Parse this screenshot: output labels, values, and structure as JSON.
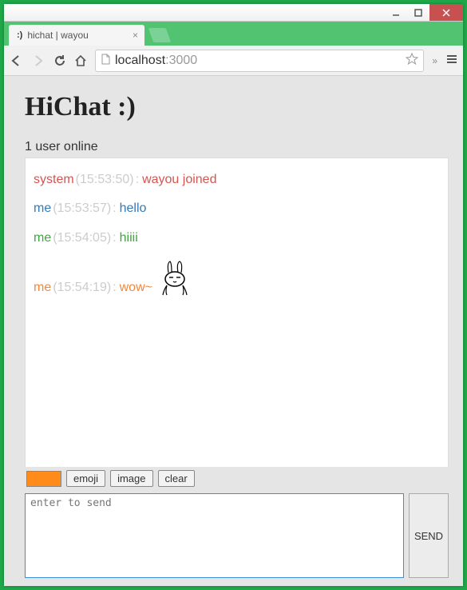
{
  "window": {
    "tab_favicon": ":)",
    "tab_title": "hichat | wayou",
    "url_scheme_host": "localhost",
    "url_port": ":3000"
  },
  "app": {
    "title": "HiChat :)",
    "user_count_text": "1 user online"
  },
  "messages": [
    {
      "cls": "m-sys",
      "name": "system",
      "time": "(15:53:50)",
      "text": "wayou joined",
      "emoji": false
    },
    {
      "cls": "m-me1",
      "name": "me",
      "time": "(15:53:57)",
      "text": "hello",
      "emoji": false
    },
    {
      "cls": "m-me2",
      "name": "me",
      "time": "(15:54:05)",
      "text": "hiiii",
      "emoji": false
    },
    {
      "cls": "m-me3",
      "name": "me",
      "time": "(15:54:19)",
      "text": "wow~",
      "emoji": true
    }
  ],
  "toolbar": {
    "color_hex": "#ff8c1a",
    "emoji_label": "emoji",
    "image_label": "image",
    "clear_label": "clear"
  },
  "input": {
    "placeholder": "enter to send",
    "send_label": "SEND"
  }
}
